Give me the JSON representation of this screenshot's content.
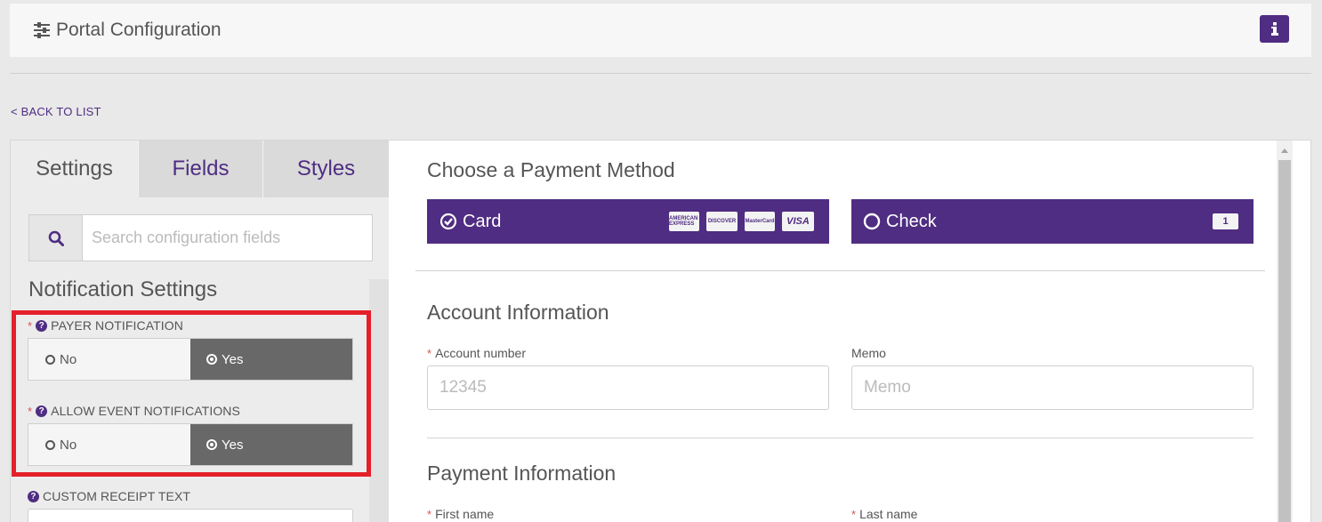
{
  "header": {
    "title": "Portal Configuration",
    "info_button": "i"
  },
  "nav": {
    "back_link": "< BACK TO LIST"
  },
  "left": {
    "tabs": [
      {
        "label": "Settings",
        "active": true
      },
      {
        "label": "Fields",
        "active": false
      },
      {
        "label": "Styles",
        "active": false
      }
    ],
    "search": {
      "placeholder": "Search configuration fields",
      "value": ""
    },
    "section_title": "Notification Settings",
    "fields": [
      {
        "label": "PAYER NOTIFICATION",
        "required": "*",
        "options": {
          "no": "No",
          "yes": "Yes"
        },
        "selected": "Yes"
      },
      {
        "label": "ALLOW EVENT NOTIFICATIONS",
        "required": "*",
        "options": {
          "no": "No",
          "yes": "Yes"
        },
        "selected": "Yes"
      },
      {
        "label": "CUSTOM RECEIPT TEXT",
        "required": ""
      }
    ]
  },
  "right": {
    "payment_method_title": "Choose a Payment Method",
    "methods": [
      {
        "label": "Card",
        "selected": true,
        "logos": [
          "AMERICAN EXPRESS",
          "DISCOVER",
          "MasterCard",
          "VISA"
        ]
      },
      {
        "label": "Check",
        "selected": false,
        "icon_text": "1"
      }
    ],
    "account_title": "Account Information",
    "account_number": {
      "label": "Account number",
      "required": "*",
      "placeholder": "12345"
    },
    "memo": {
      "label": "Memo",
      "placeholder": "Memo"
    },
    "payment_title": "Payment Information",
    "first_name": {
      "label": "First name",
      "required": "*"
    },
    "last_name": {
      "label": "Last name",
      "required": "*"
    }
  },
  "colors": {
    "brand": "#4f2d82",
    "highlight": "#e4202a",
    "toggle_selected": "#686868"
  }
}
